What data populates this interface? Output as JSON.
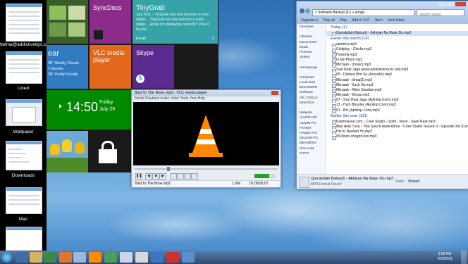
{
  "switcher": {
    "items": [
      {
        "label": "fatima@addictivetips.com"
      },
      {
        "label": "Lined"
      },
      {
        "label": "Wallpaper"
      },
      {
        "label": "Downloads"
      },
      {
        "label": "Mac"
      }
    ]
  },
  "tiles": {
    "syncdocs": {
      "title": "SyncDocs"
    },
    "tinygrab": {
      "title": "TinyGrab",
      "text": "July 2011 – TinyGrab has now become a more stable… TinyGrab has now become a more stable… Email not displaying correctly? View it in your …",
      "footer": "Email",
      "count": "2"
    },
    "weather": {
      "temp": "ear",
      "line1": "30° Mostly Cloudy",
      "line2": "T-storms",
      "line3": "28° Partly Cloudy"
    },
    "vlc": {
      "title": "VLC media player"
    },
    "skype": {
      "title": "Skype"
    },
    "clock": {
      "time": "14:50",
      "day": "Friday",
      "date": "July 29"
    }
  },
  "vlc_window": {
    "title": "Bad To The Bone.mp3 - VLC media player",
    "menu": "Media   Playback   Audio   Video   Tools   View   Help",
    "file": "Bad To The Bone.mp3",
    "speed": "1.00x",
    "time": "01:05/05:07"
  },
  "explorer": {
    "address": "« Software Backup (F:) » songs",
    "search_placeholder": "Search songs",
    "toolbar": [
      "Organize ▾",
      "Play all",
      "Play",
      "Add to VLC",
      "Burn",
      "New folder"
    ],
    "nav": [
      "Favorites",
      "",
      "Libraries",
      "Documents",
      "Music",
      "Pictures",
      "Videos",
      "",
      "Homegroup",
      "",
      "Computer",
      "Local Disk",
      "BACONSIR",
      "Software",
      "HP_TOOLS",
      "MAKODA",
      "",
      "Network",
      "AJUTRI-PC",
      "ADMIN-PC",
      "FATIMA",
      "HAMZA-PC",
      "MAJAMI-PC",
      "MEHWISH",
      "MALAAM",
      "TUTO"
    ],
    "sections": [
      {
        "header": "Today (1)",
        "files": [
          "Qurratulain Balouch - Akhiyan Na Raan Do.mp3"
        ]
      },
      {
        "header": "Earlier this month (14)",
        "files": [
          "aaoteco.mp3",
          "Coldplay - Clocks.mp3",
          "Hysteria.mp3",
          "In My Place.mp3",
          "Mizraab - [music].mp3",
          "Sazi Raat Jaga [www.addictivemusic.net].mp3",
          "05 - Dobara Phir Se (Acoustic).mp3",
          "Mizraab - Ishaq[1].mp3",
          "Mizraab - Kuch Ha.mp3",
          "Mizraab - Ritmi Saudian.mp3",
          "Mizraab - Ehsas.mp3",
          "07 - Sazi Raat Jaga (Aplnlop.Com).mp3",
          "13 - Hum Bhooley (Apnilop.Com).mp3",
          "01 - Bol (Apnilop.Com).mp3"
        ]
      },
      {
        "header": "Earlier this year (131)",
        "files": [
          "Kashmaone.com - Coke Studio - Spirit - Noori - Saari Raat.mp3",
          "Man Amp Tuna - Tina Sani & Arieb Azhar - Coke Studio Season 3 - Episode 3rd (Conception) - C",
          "Hai Ki Neelam Ho.mp3",
          "05-Noori-shagoti koo.mp3"
        ]
      }
    ],
    "status_title": "Qurratulain Balouch - Akhiyan Na Raan Do.mp3",
    "status_type": "MP3 Format Sound",
    "status_state_label": "State:",
    "status_state": "Shared"
  },
  "taskbar": {
    "clock_time": "2:50 PM",
    "clock_date": "7/29/2011"
  }
}
